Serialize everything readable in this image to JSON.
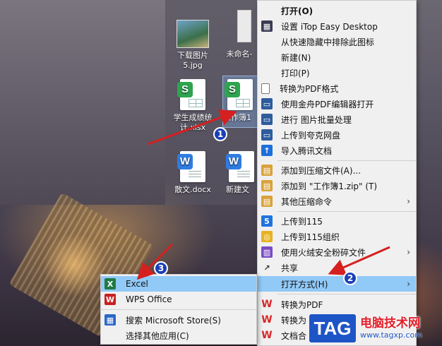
{
  "desktop": {
    "files": [
      {
        "label": "下载图片5.jpg",
        "kind": "image"
      },
      {
        "label": "未命名-",
        "kind": "image-partial"
      },
      {
        "label": "学生成绩统计.xlsx",
        "kind": "spreadsheet",
        "badge": "S"
      },
      {
        "label": "工作簿1",
        "kind": "spreadsheet",
        "badge": "S",
        "selected": true
      },
      {
        "label": "散文.docx",
        "kind": "document",
        "badge": "W"
      },
      {
        "label": "新建文",
        "kind": "document",
        "badge": "W"
      }
    ]
  },
  "context_menu": {
    "items": [
      {
        "label": "打开(O)",
        "icon": "none",
        "bold": true
      },
      {
        "label": "设置 iTop Easy Desktop",
        "icon": "app-grid-icon"
      },
      {
        "label": "从快速隐藏中排除此图标",
        "icon": "none"
      },
      {
        "label": "新建(N)",
        "icon": "none"
      },
      {
        "label": "打印(P)",
        "icon": "none"
      },
      {
        "label": "转换为PDF格式",
        "icon": "page-icon"
      },
      {
        "label": "使用金舟PDF编辑器打开",
        "icon": "window-icon"
      },
      {
        "label": "进行 图片批量处理",
        "icon": "window-icon"
      },
      {
        "label": "上传到夸克网盘",
        "icon": "window-icon"
      },
      {
        "label": "导入腾讯文档",
        "icon": "cloud-icon"
      },
      {
        "label": "添加到压缩文件(A)...",
        "icon": "zip-icon"
      },
      {
        "label": "添加到 \"工作簿1.zip\" (T)",
        "icon": "zip-icon"
      },
      {
        "label": "其他压缩命令",
        "icon": "zip-icon",
        "submenu": true
      },
      {
        "label": "上传到115",
        "icon": "115-icon"
      },
      {
        "label": "上传到115组织",
        "icon": "115-org-icon"
      },
      {
        "label": "使用火绒安全粉碎文件",
        "icon": "shredder-icon",
        "submenu": true
      },
      {
        "label": "共享",
        "icon": "share-icon"
      },
      {
        "label": "打开方式(H)",
        "icon": "none",
        "submenu": true,
        "highlighted": true
      },
      {
        "label": "转换为PDF",
        "icon": "wps-icon"
      },
      {
        "label": "转换为",
        "icon": "wps-icon"
      },
      {
        "label": "文档合",
        "icon": "wps-icon"
      }
    ]
  },
  "open_with_submenu": {
    "items": [
      {
        "label": "Excel",
        "icon": "excel-icon",
        "highlighted": true
      },
      {
        "label": "WPS Office",
        "icon": "wps-office-icon"
      },
      {
        "label": "搜索 Microsoft Store(S)",
        "icon": "store-icon"
      },
      {
        "label": "选择其他应用(C)",
        "icon": "none"
      }
    ]
  },
  "annotations": {
    "steps": [
      "1",
      "2",
      "3"
    ],
    "arrow_color": "#d61f1f",
    "badge_color": "#1a3fb8"
  },
  "watermark": {
    "tag": "TAG",
    "title": "电脑技术网",
    "url": "www.tagxp.com"
  }
}
